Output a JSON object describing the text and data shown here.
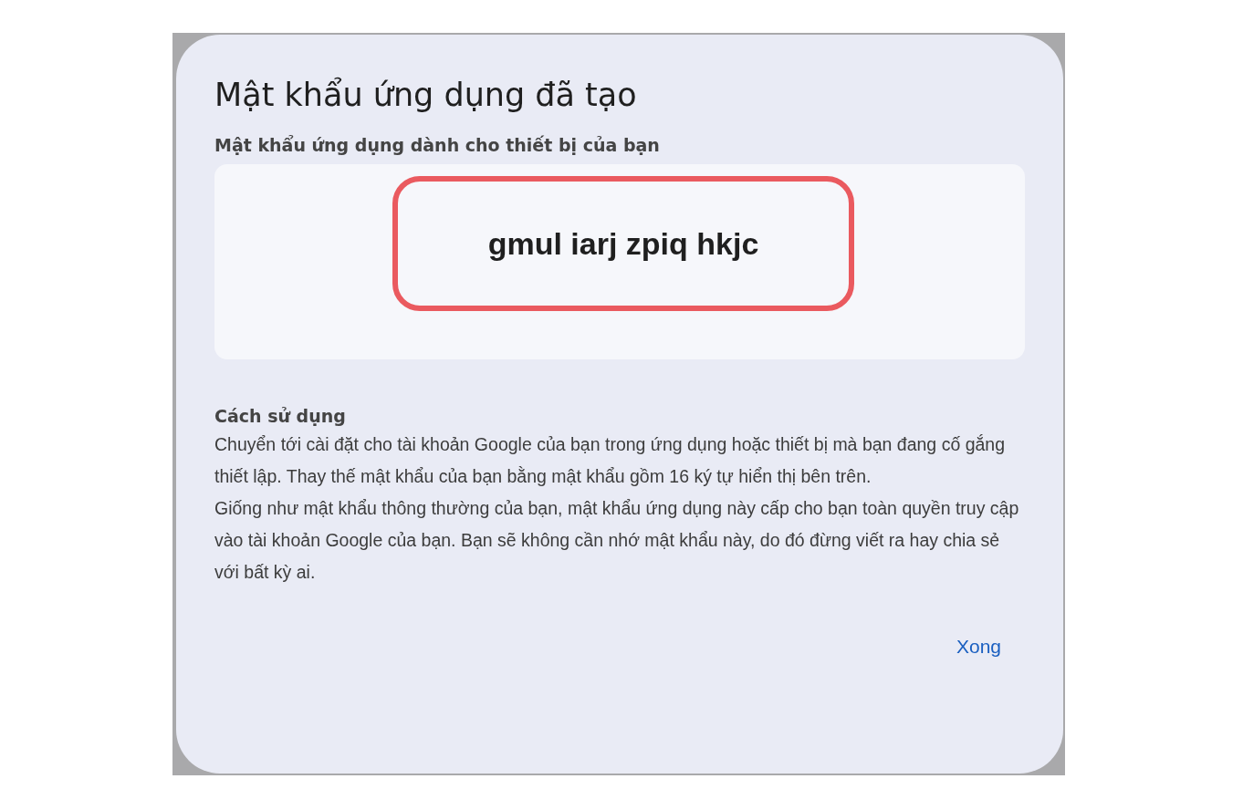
{
  "dialog": {
    "title": "Mật khẩu ứng dụng đã tạo",
    "password_label": "Mật khẩu ứng dụng dành cho thiết bị của bạn",
    "password": "gmul iarj zpiq hkjc",
    "password_highlighted": true,
    "usage_heading": "Cách sử dụng",
    "usage_paragraphs": [
      "Chuyển tới cài đặt cho tài khoản Google của bạn trong ứng dụng hoặc thiết bị mà bạn đang cố gắng thiết lập. Thay thế mật khẩu của bạn bằng mật khẩu gồm 16 ký tự hiển thị bên trên.",
      "Giống như mật khẩu thông thường của bạn, mật khẩu ứng dụng này cấp cho bạn toàn quyền truy cập vào tài khoản Google của bạn. Bạn sẽ không cần nhớ mật khẩu này, do đó đừng viết ra hay chia sẻ với bất kỳ ai."
    ],
    "done_button": "Xong"
  }
}
